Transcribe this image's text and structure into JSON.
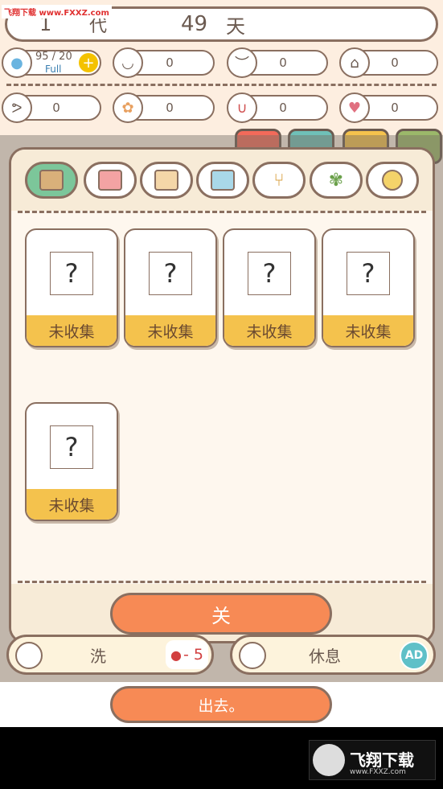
{
  "header": {
    "watermark": "飞翔下载 www.FXXZ.com",
    "generation_number": "1",
    "generation_label": "代",
    "days_number": "49",
    "days_label": "天"
  },
  "stats": {
    "water": "95 / 20",
    "water_status": "Full",
    "hunger": "0",
    "mood": "0",
    "shower": "0",
    "strength": "0",
    "brain": "0",
    "magnet": "0",
    "love": "0"
  },
  "collection_tabs": [
    {
      "icon": "floor-icon",
      "active": true
    },
    {
      "icon": "wallpaper-icon",
      "active": false
    },
    {
      "icon": "frame-icon",
      "active": false
    },
    {
      "icon": "window-icon",
      "active": false
    },
    {
      "icon": "chair-icon",
      "active": false
    },
    {
      "icon": "plant-icon",
      "active": false
    },
    {
      "icon": "ball-icon",
      "active": false
    }
  ],
  "items": [
    {
      "symbol": "?",
      "status": "未收集"
    },
    {
      "symbol": "?",
      "status": "未收集"
    },
    {
      "symbol": "?",
      "status": "未收集"
    },
    {
      "symbol": "?",
      "status": "未收集"
    },
    {
      "symbol": "?",
      "status": "未收集"
    }
  ],
  "close_label": "关",
  "actions": {
    "wash_label": "洗",
    "wash_cost": "- 5",
    "rest_label": "休息",
    "ad_label": "AD"
  },
  "outing_label": "出去。",
  "brand": {
    "name": "飞翔下载",
    "url": "www.FXXZ.com"
  },
  "colors": {
    "accent_orange": "#f78a55",
    "card_footer": "#f4c24d",
    "active_tab": "#7cc69a",
    "outline": "#8a6f60"
  }
}
